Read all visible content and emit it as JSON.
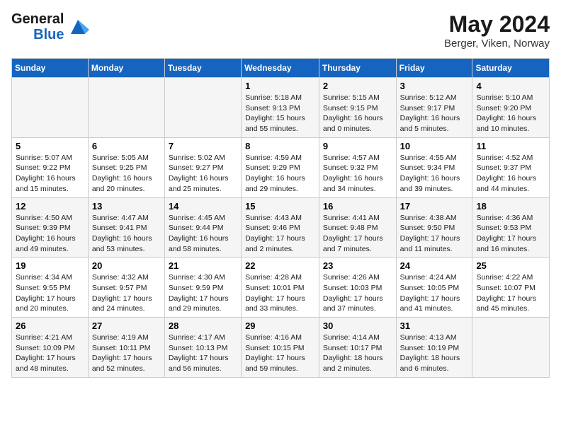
{
  "logo": {
    "line1": "General",
    "line2": "Blue"
  },
  "title": "May 2024",
  "subtitle": "Berger, Viken, Norway",
  "headers": [
    "Sunday",
    "Monday",
    "Tuesday",
    "Wednesday",
    "Thursday",
    "Friday",
    "Saturday"
  ],
  "weeks": [
    [
      {
        "day": "",
        "info": ""
      },
      {
        "day": "",
        "info": ""
      },
      {
        "day": "",
        "info": ""
      },
      {
        "day": "1",
        "info": "Sunrise: 5:18 AM\nSunset: 9:13 PM\nDaylight: 15 hours\nand 55 minutes."
      },
      {
        "day": "2",
        "info": "Sunrise: 5:15 AM\nSunset: 9:15 PM\nDaylight: 16 hours\nand 0 minutes."
      },
      {
        "day": "3",
        "info": "Sunrise: 5:12 AM\nSunset: 9:17 PM\nDaylight: 16 hours\nand 5 minutes."
      },
      {
        "day": "4",
        "info": "Sunrise: 5:10 AM\nSunset: 9:20 PM\nDaylight: 16 hours\nand 10 minutes."
      }
    ],
    [
      {
        "day": "5",
        "info": "Sunrise: 5:07 AM\nSunset: 9:22 PM\nDaylight: 16 hours\nand 15 minutes."
      },
      {
        "day": "6",
        "info": "Sunrise: 5:05 AM\nSunset: 9:25 PM\nDaylight: 16 hours\nand 20 minutes."
      },
      {
        "day": "7",
        "info": "Sunrise: 5:02 AM\nSunset: 9:27 PM\nDaylight: 16 hours\nand 25 minutes."
      },
      {
        "day": "8",
        "info": "Sunrise: 4:59 AM\nSunset: 9:29 PM\nDaylight: 16 hours\nand 29 minutes."
      },
      {
        "day": "9",
        "info": "Sunrise: 4:57 AM\nSunset: 9:32 PM\nDaylight: 16 hours\nand 34 minutes."
      },
      {
        "day": "10",
        "info": "Sunrise: 4:55 AM\nSunset: 9:34 PM\nDaylight: 16 hours\nand 39 minutes."
      },
      {
        "day": "11",
        "info": "Sunrise: 4:52 AM\nSunset: 9:37 PM\nDaylight: 16 hours\nand 44 minutes."
      }
    ],
    [
      {
        "day": "12",
        "info": "Sunrise: 4:50 AM\nSunset: 9:39 PM\nDaylight: 16 hours\nand 49 minutes."
      },
      {
        "day": "13",
        "info": "Sunrise: 4:47 AM\nSunset: 9:41 PM\nDaylight: 16 hours\nand 53 minutes."
      },
      {
        "day": "14",
        "info": "Sunrise: 4:45 AM\nSunset: 9:44 PM\nDaylight: 16 hours\nand 58 minutes."
      },
      {
        "day": "15",
        "info": "Sunrise: 4:43 AM\nSunset: 9:46 PM\nDaylight: 17 hours\nand 2 minutes."
      },
      {
        "day": "16",
        "info": "Sunrise: 4:41 AM\nSunset: 9:48 PM\nDaylight: 17 hours\nand 7 minutes."
      },
      {
        "day": "17",
        "info": "Sunrise: 4:38 AM\nSunset: 9:50 PM\nDaylight: 17 hours\nand 11 minutes."
      },
      {
        "day": "18",
        "info": "Sunrise: 4:36 AM\nSunset: 9:53 PM\nDaylight: 17 hours\nand 16 minutes."
      }
    ],
    [
      {
        "day": "19",
        "info": "Sunrise: 4:34 AM\nSunset: 9:55 PM\nDaylight: 17 hours\nand 20 minutes."
      },
      {
        "day": "20",
        "info": "Sunrise: 4:32 AM\nSunset: 9:57 PM\nDaylight: 17 hours\nand 24 minutes."
      },
      {
        "day": "21",
        "info": "Sunrise: 4:30 AM\nSunset: 9:59 PM\nDaylight: 17 hours\nand 29 minutes."
      },
      {
        "day": "22",
        "info": "Sunrise: 4:28 AM\nSunset: 10:01 PM\nDaylight: 17 hours\nand 33 minutes."
      },
      {
        "day": "23",
        "info": "Sunrise: 4:26 AM\nSunset: 10:03 PM\nDaylight: 17 hours\nand 37 minutes."
      },
      {
        "day": "24",
        "info": "Sunrise: 4:24 AM\nSunset: 10:05 PM\nDaylight: 17 hours\nand 41 minutes."
      },
      {
        "day": "25",
        "info": "Sunrise: 4:22 AM\nSunset: 10:07 PM\nDaylight: 17 hours\nand 45 minutes."
      }
    ],
    [
      {
        "day": "26",
        "info": "Sunrise: 4:21 AM\nSunset: 10:09 PM\nDaylight: 17 hours\nand 48 minutes."
      },
      {
        "day": "27",
        "info": "Sunrise: 4:19 AM\nSunset: 10:11 PM\nDaylight: 17 hours\nand 52 minutes."
      },
      {
        "day": "28",
        "info": "Sunrise: 4:17 AM\nSunset: 10:13 PM\nDaylight: 17 hours\nand 56 minutes."
      },
      {
        "day": "29",
        "info": "Sunrise: 4:16 AM\nSunset: 10:15 PM\nDaylight: 17 hours\nand 59 minutes."
      },
      {
        "day": "30",
        "info": "Sunrise: 4:14 AM\nSunset: 10:17 PM\nDaylight: 18 hours\nand 2 minutes."
      },
      {
        "day": "31",
        "info": "Sunrise: 4:13 AM\nSunset: 10:19 PM\nDaylight: 18 hours\nand 6 minutes."
      },
      {
        "day": "",
        "info": ""
      }
    ]
  ]
}
